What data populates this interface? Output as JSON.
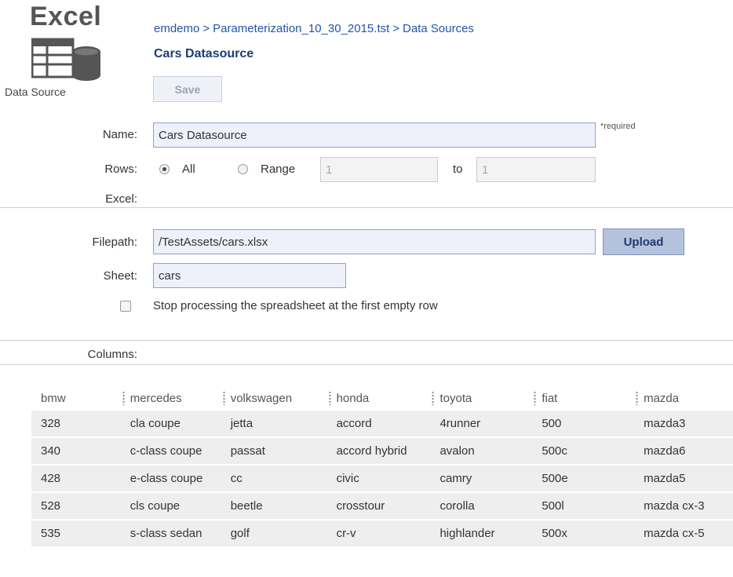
{
  "logo": {
    "title": "Excel",
    "caption": "Data Source",
    "icon": "excel-datasource-icon"
  },
  "header": {
    "breadcrumb": [
      "emdemo",
      "Parameterization_10_30_2015.tst",
      "Data Sources"
    ],
    "separator": ">",
    "title": "Cars Datasource",
    "save_label": "Save"
  },
  "form": {
    "name_label": "Name:",
    "name_value": "Cars Datasource",
    "required_note": "*required",
    "rows_label": "Rows:",
    "rows_all_label": "All",
    "rows_range_label": "Range",
    "rows_selected": "All",
    "range_from": "1",
    "range_to_label": "to",
    "range_to": "1",
    "excel_label": "Excel:"
  },
  "excel": {
    "filepath_label": "Filepath:",
    "filepath_value": "/TestAssets/cars.xlsx",
    "upload_label": "Upload",
    "sheet_label": "Sheet:",
    "sheet_value": "cars",
    "stop_label": "Stop processing the spreadsheet at the first empty row",
    "stop_checked": false
  },
  "columns": {
    "label": "Columns:",
    "headers": [
      "bmw",
      "mercedes",
      "volkswagen",
      "honda",
      "toyota",
      "fiat",
      "mazda"
    ],
    "rows": [
      [
        "328",
        "cla coupe",
        "jetta",
        "accord",
        "4runner",
        "500",
        "mazda3"
      ],
      [
        "340",
        "c-class coupe",
        "passat",
        "accord hybrid",
        "avalon",
        "500c",
        "mazda6"
      ],
      [
        "428",
        "e-class coupe",
        "cc",
        "civic",
        "camry",
        "500e",
        "mazda5"
      ],
      [
        "528",
        "cls coupe",
        "beetle",
        "crosstour",
        "corolla",
        "500l",
        "mazda cx-3"
      ],
      [
        "535",
        "s-class sedan",
        "golf",
        "cr-v",
        "highlander",
        "500x",
        "mazda cx-5"
      ]
    ]
  }
}
